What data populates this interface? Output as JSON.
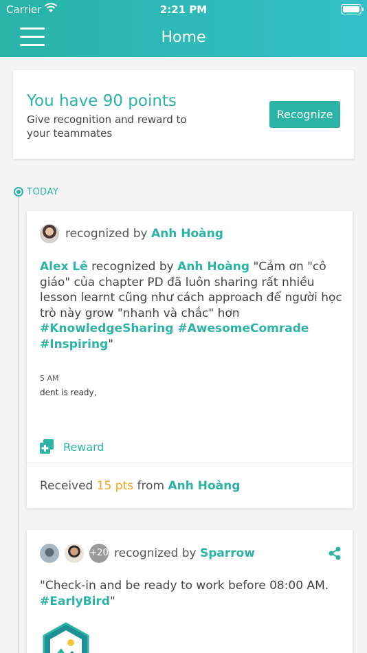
{
  "status_bar": {
    "carrier": "Carrier",
    "time": "2:21 PM",
    "battery_level": 1.0
  },
  "header": {
    "title": "Home"
  },
  "points_card": {
    "title": "You have 90 points",
    "subtitle": "Give recognition and reward to your teammates",
    "button_label": "Recognize"
  },
  "timeline": {
    "section_label": "TODAY"
  },
  "feed": [
    {
      "recognized_by_prefix": "recognized by",
      "recognizer": "Anh Hoàng",
      "message_recipient": "Alex Lê",
      "message_connector": "recognized by",
      "message_author": "Anh Hoàng",
      "message_text": "\"Cảm ơn \"cô giáo\" của chapter PD đã luôn sharing rất nhiều lesson learnt cũng như cách approach để người học trò này grow \"nhanh và chắc\" hơn",
      "hashtags": "#KnowledgeSharing #AwesomeComrade #Inspiring",
      "message_close": "\"",
      "stamp_time": "5 AM",
      "stamp_text": "dent is ready,",
      "reward_label": "Reward",
      "received_prefix": "Received",
      "received_points": "15 pts",
      "received_from": "from",
      "received_sender": "Anh Hoàng"
    },
    {
      "more_count": "+20",
      "recognized_by_prefix": "recognized by",
      "recognizer": "Sparrow",
      "message_text": " \"Check-in and be ready to work before 08:00 AM.",
      "hashtags": "#EarlyBird",
      "message_close": "\""
    }
  ],
  "colors": {
    "accent": "#2bb3a5",
    "points_highlight": "#f3a21b",
    "header_gradient_end": "#33c0c9"
  },
  "icons": [
    "wifi-icon",
    "battery-icon",
    "menu-icon",
    "reward-icon",
    "share-icon",
    "badge-icon"
  ]
}
